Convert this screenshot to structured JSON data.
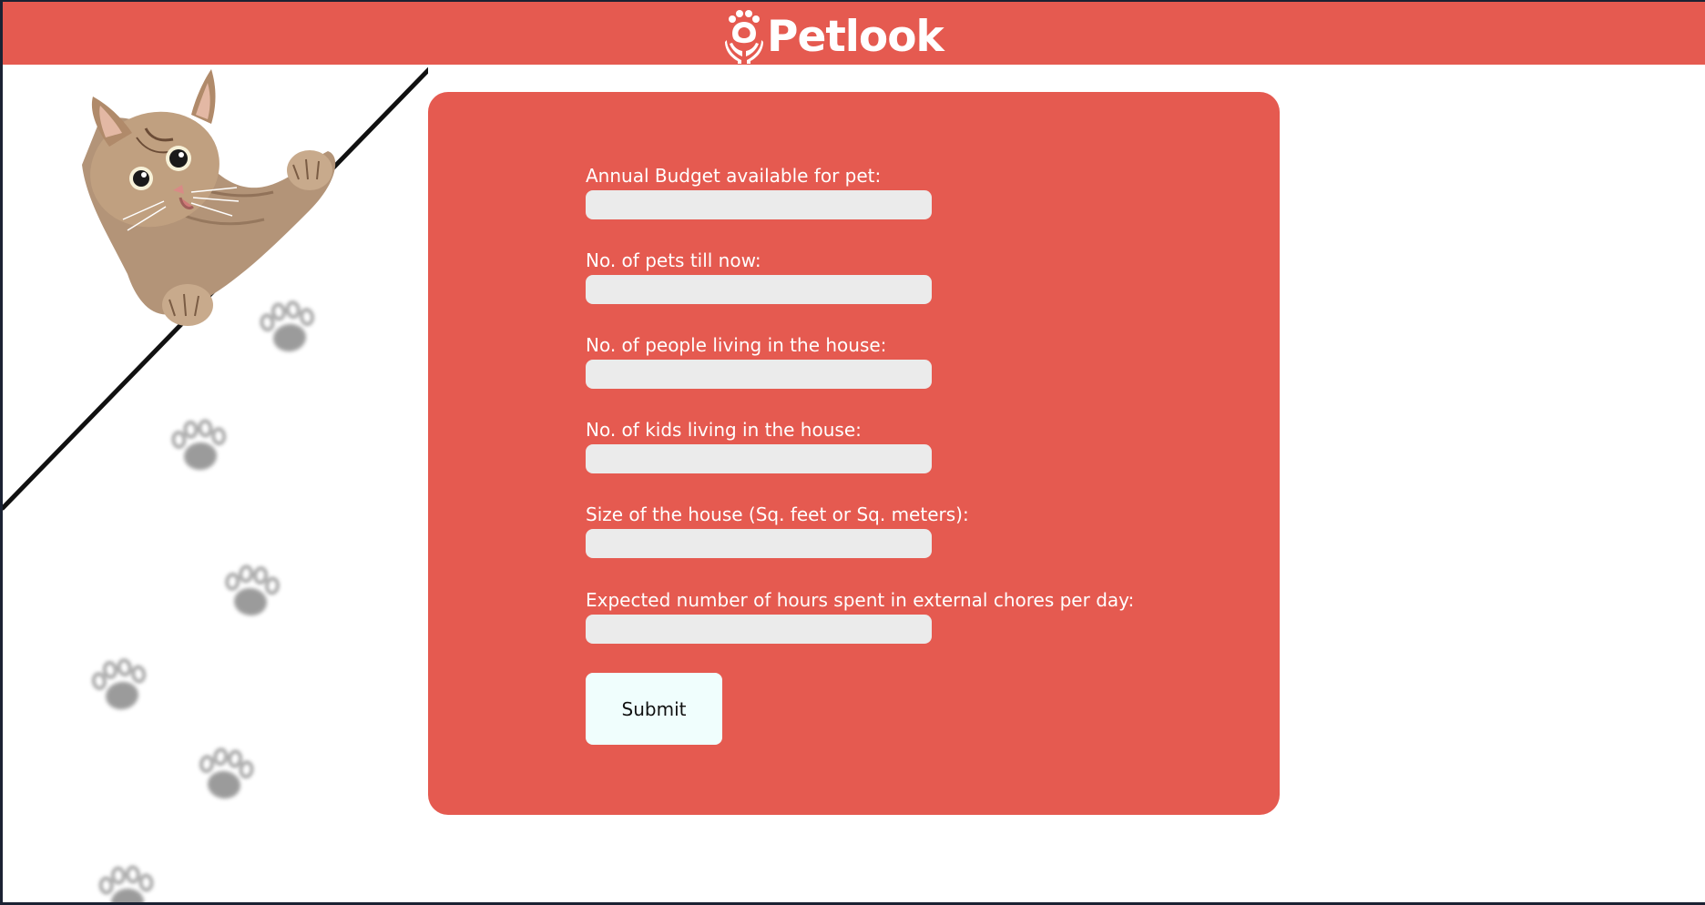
{
  "header": {
    "brand_name": "Petlook",
    "logo_icon": "paw-hands-logo-icon",
    "background": "#e55a50"
  },
  "decoration": {
    "image": "cat-peeking-over-line",
    "paw_prints": "paw-print-icon"
  },
  "form": {
    "background": "#e55a50",
    "fields": [
      {
        "label": "Annual Budget available for pet:",
        "value": ""
      },
      {
        "label": "No. of pets till now:",
        "value": ""
      },
      {
        "label": "No. of people living in the house:",
        "value": ""
      },
      {
        "label": "No. of kids living in the house:",
        "value": ""
      },
      {
        "label": "Size of the house (Sq. feet or Sq. meters):",
        "value": ""
      },
      {
        "label": "Expected number of hours spent in external chores per day:",
        "value": ""
      }
    ],
    "submit_label": "Submit"
  }
}
